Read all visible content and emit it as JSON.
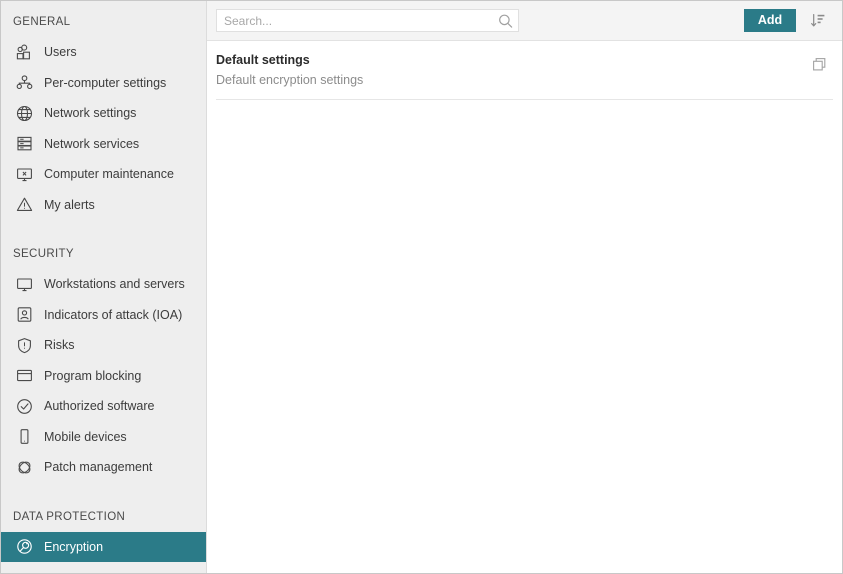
{
  "sidebar": {
    "sections": [
      {
        "title": "GENERAL",
        "items": [
          {
            "label": "Users",
            "icon": "users-icon"
          },
          {
            "label": "Per-computer settings",
            "icon": "per-computer-settings-icon"
          },
          {
            "label": "Network settings",
            "icon": "globe-icon"
          },
          {
            "label": "Network services",
            "icon": "server-icon"
          },
          {
            "label": "Computer maintenance",
            "icon": "monitor-maintenance-icon"
          },
          {
            "label": "My alerts",
            "icon": "warning-triangle-icon"
          }
        ]
      },
      {
        "title": "SECURITY",
        "items": [
          {
            "label": "Workstations and servers",
            "icon": "monitor-icon"
          },
          {
            "label": "Indicators of attack (IOA)",
            "icon": "person-badge-icon"
          },
          {
            "label": "Risks",
            "icon": "shield-alert-icon"
          },
          {
            "label": "Program blocking",
            "icon": "window-icon"
          },
          {
            "label": "Authorized software",
            "icon": "check-circle-icon"
          },
          {
            "label": "Mobile devices",
            "icon": "mobile-device-icon"
          },
          {
            "label": "Patch management",
            "icon": "patch-links-icon"
          }
        ]
      },
      {
        "title": "DATA PROTECTION",
        "items": [
          {
            "label": "Encryption",
            "icon": "encryption-disc-icon",
            "selected": true
          }
        ]
      }
    ]
  },
  "toolbar": {
    "search_placeholder": "Search...",
    "search_value": "",
    "search_icon": "search-icon",
    "add_label": "Add",
    "sort_icon": "sort-descending-icon"
  },
  "content": {
    "rows": [
      {
        "title": "Default settings",
        "subtitle": "Default encryption settings",
        "action_icon": "copy-icon"
      }
    ]
  },
  "colors": {
    "accent": "#2b7b88",
    "sidebar_bg": "#eeeeee",
    "toolbar_bg": "#f4f4f4",
    "content_bg": "#ffffff",
    "text": "#3c3c3c",
    "muted_text": "#8c8c8c"
  }
}
